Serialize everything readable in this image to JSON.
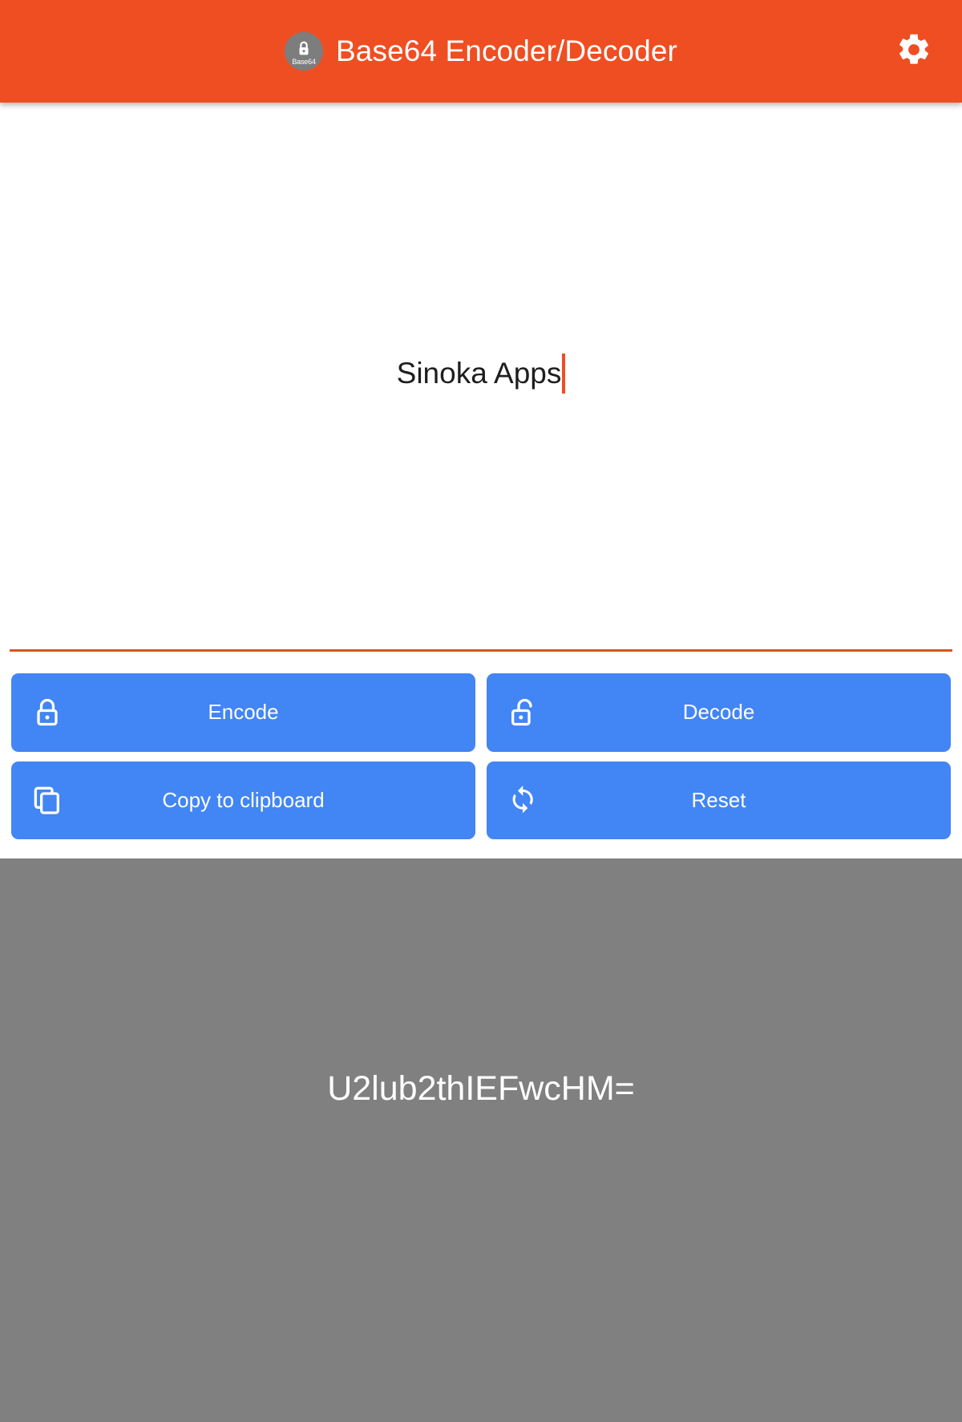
{
  "appbar": {
    "title": "Base64 Encoder/Decoder",
    "icon_caption": "Base64",
    "icon_name": "app-lock-icon",
    "settings_icon": "gear-icon",
    "background_color": "#EF4E23",
    "title_color": "#FFFFFF"
  },
  "input": {
    "value": "Sinoka Apps",
    "placeholder": "",
    "caret_color": "#EF4E23",
    "underline_color": "#D9541F",
    "text_color": "#1E1E1E"
  },
  "buttons": [
    {
      "label": "Encode",
      "icon": "lock-closed-icon",
      "color": "#4285F4"
    },
    {
      "label": "Decode",
      "icon": "lock-open-icon",
      "color": "#4285F4"
    },
    {
      "label": "Copy to clipboard",
      "icon": "copy-icon",
      "color": "#4285F4"
    },
    {
      "label": "Reset",
      "icon": "refresh-sync-icon",
      "color": "#4285F4"
    }
  ],
  "output": {
    "value": "U2lub2thIEFwcHM=",
    "background_color": "#808080",
    "text_color": "#FFFFFF"
  }
}
